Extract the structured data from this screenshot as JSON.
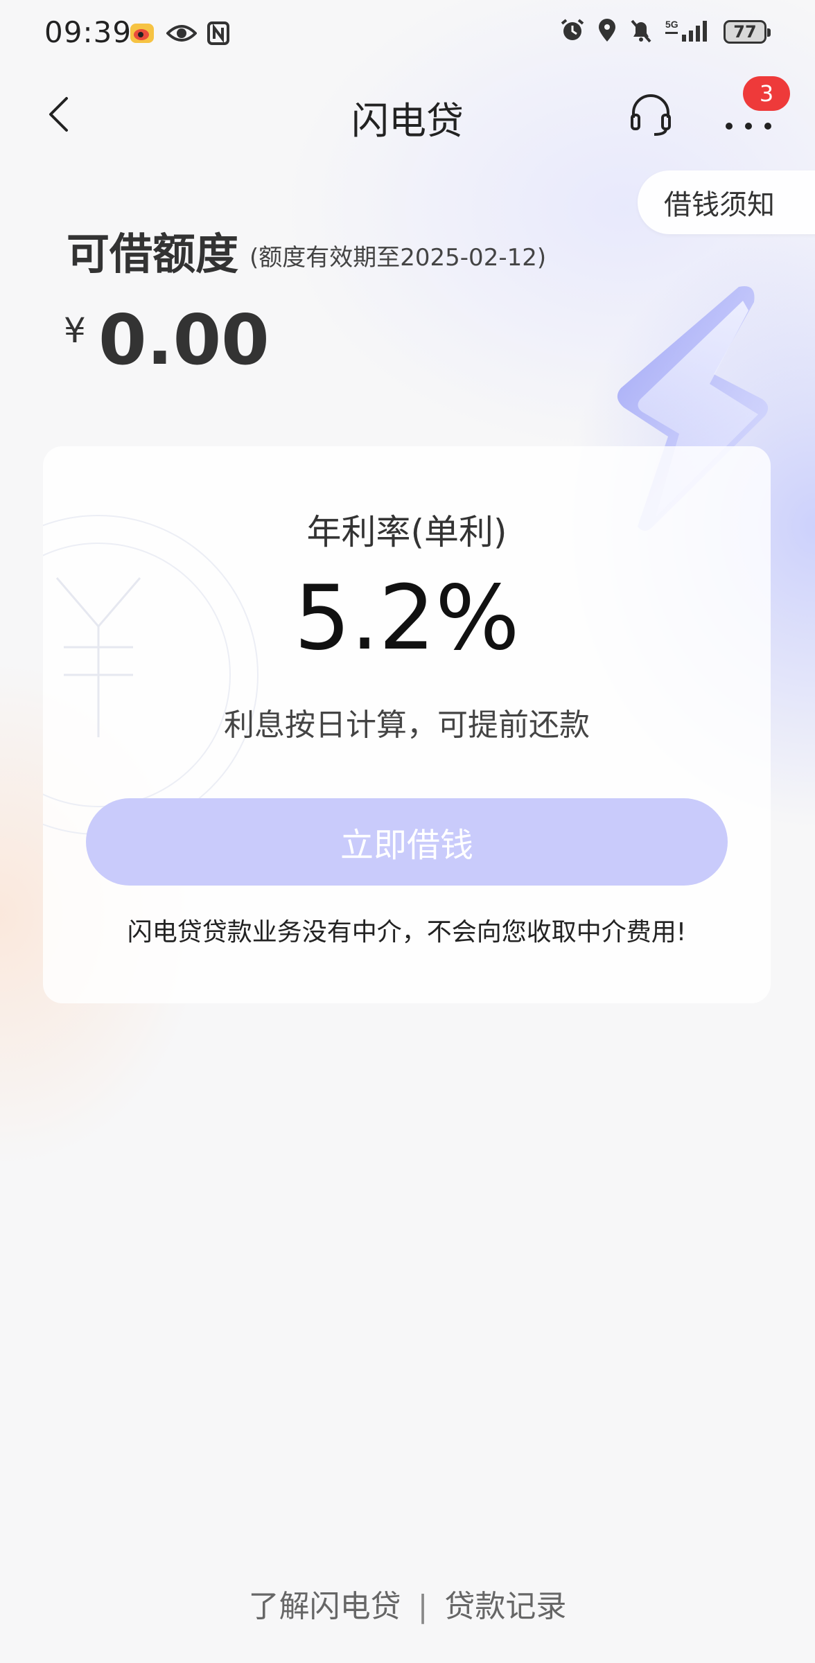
{
  "status_bar": {
    "time": "09:39",
    "network": "5G",
    "battery": "77",
    "left_icons": [
      "weibo-icon",
      "eye-icon",
      "nfc-icon"
    ],
    "right_icons": [
      "alarm-icon",
      "location-icon",
      "mute-icon",
      "signal-icon",
      "battery-icon"
    ]
  },
  "nav": {
    "title": "闪电贷",
    "badge_count": "3",
    "icons": [
      "back-icon",
      "headset-icon",
      "more-icon"
    ]
  },
  "notice_tab": {
    "label": "借钱须知"
  },
  "credit": {
    "title": "可借额度",
    "validity": "(额度有效期至2025-02-12)",
    "currency_symbol": "¥",
    "amount": "0.00"
  },
  "rate_card": {
    "label": "年利率(单利)",
    "value": "5.2%",
    "note": "利息按日计算，可提前还款",
    "button_label": "立即借钱",
    "disclaimer": "闪电贷贷款业务没有中介，不会向您收取中介费用!"
  },
  "footer": {
    "link_about": "了解闪电贷",
    "separator": "|",
    "link_records": "贷款记录"
  },
  "colors": {
    "button_disabled": "#c9cbfb",
    "badge": "#ee3a3a",
    "background": "#f7f7f8"
  }
}
